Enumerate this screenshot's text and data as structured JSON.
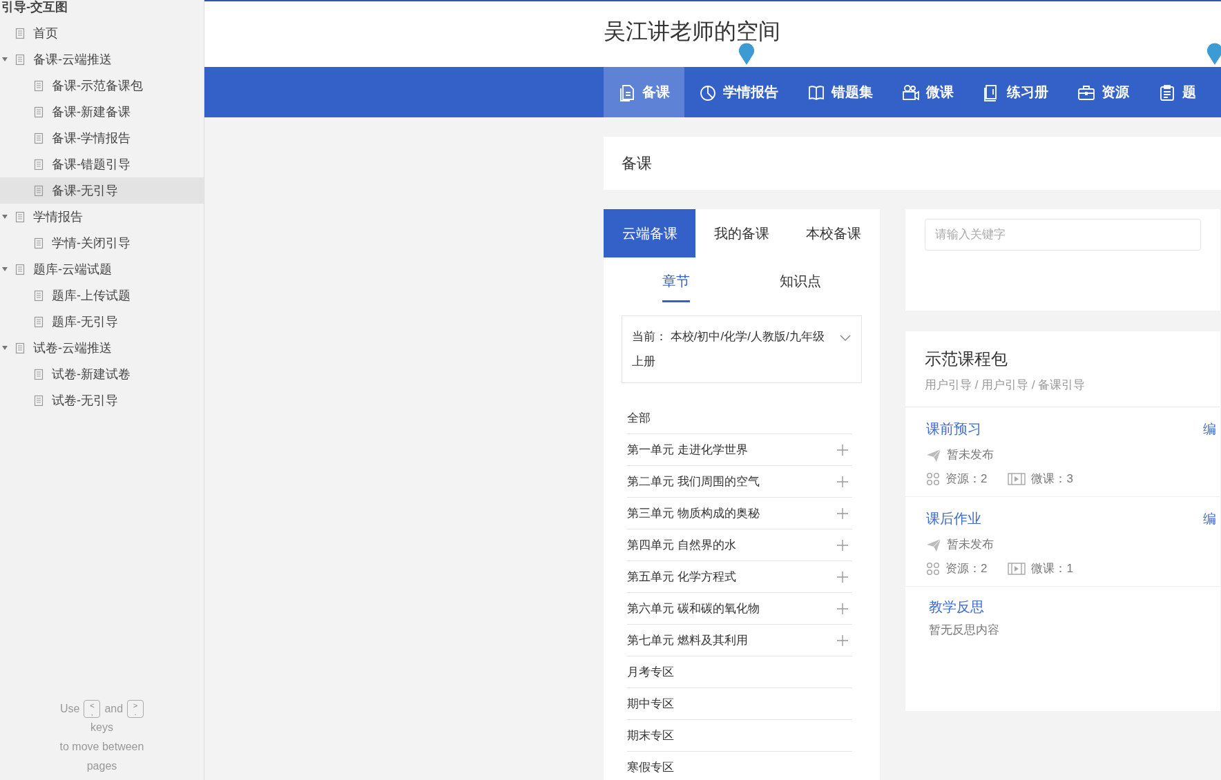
{
  "sidebar": {
    "title": "引导-交互图",
    "items": [
      {
        "label": "首页",
        "selected": false
      },
      {
        "label": "备课-云端推送",
        "selected": false,
        "expanded": true,
        "children": [
          {
            "label": "备课-示范备课包",
            "selected": false
          },
          {
            "label": "备课-新建备课",
            "selected": false
          },
          {
            "label": "备课-学情报告",
            "selected": false
          },
          {
            "label": "备课-错题引导",
            "selected": false
          },
          {
            "label": "备课-无引导",
            "selected": true
          }
        ]
      },
      {
        "label": "学情报告",
        "selected": false,
        "expanded": true,
        "children": [
          {
            "label": "学情-关闭引导",
            "selected": false
          }
        ]
      },
      {
        "label": "题库-云端试题",
        "selected": false,
        "expanded": true,
        "children": [
          {
            "label": "题库-上传试题",
            "selected": false
          },
          {
            "label": "题库-无引导",
            "selected": false
          }
        ]
      },
      {
        "label": "试卷-云端推送",
        "selected": false,
        "expanded": true,
        "children": [
          {
            "label": "试卷-新建试卷",
            "selected": false
          },
          {
            "label": "试卷-无引导",
            "selected": false
          }
        ]
      }
    ],
    "hint": {
      "before": "Use",
      "key1": {
        "upper": "<",
        "lower": ","
      },
      "middle": "and",
      "key2": {
        "upper": ">",
        "lower": "."
      },
      "after": "keys",
      "line2": "to move between pages"
    }
  },
  "header": {
    "title": "吴江讲老师的空间"
  },
  "nav": [
    {
      "label": "备课",
      "selected": true
    },
    {
      "label": "学情报告",
      "selected": false
    },
    {
      "label": "错题集",
      "selected": false
    },
    {
      "label": "微课",
      "selected": false
    },
    {
      "label": "练习册",
      "selected": false
    },
    {
      "label": "资源",
      "selected": false
    },
    {
      "label": "题",
      "selected": false
    }
  ],
  "page_title": "备课",
  "tabs": [
    {
      "label": "云端备课",
      "selected": true
    },
    {
      "label": "我的备课",
      "selected": false
    },
    {
      "label": "本校备课",
      "selected": false
    }
  ],
  "subtabs": [
    {
      "label": "章节",
      "selected": true
    },
    {
      "label": "知识点",
      "selected": false
    }
  ],
  "current": "当前： 本校/初中/化学/人教版/九年级上册",
  "chapters": [
    {
      "label": "全部",
      "expandable": false
    },
    {
      "label": "第一单元 走进化学世界",
      "expandable": true
    },
    {
      "label": "第二单元 我们周围的空气",
      "expandable": true
    },
    {
      "label": "第三单元 物质构成的奥秘",
      "expandable": true
    },
    {
      "label": "第四单元 自然界的水",
      "expandable": true
    },
    {
      "label": "第五单元 化学方程式",
      "expandable": true
    },
    {
      "label": "第六单元 碳和碳的氧化物",
      "expandable": true
    },
    {
      "label": "第七单元 燃料及其利用",
      "expandable": true
    },
    {
      "label": "月考专区",
      "expandable": false
    },
    {
      "label": "期中专区",
      "expandable": false
    },
    {
      "label": "期末专区",
      "expandable": false
    },
    {
      "label": "寒假专区",
      "expandable": false
    }
  ],
  "search": {
    "placeholder": "请输入关键字"
  },
  "package": {
    "title": "示范课程包",
    "breadcrumb": "用户引导 / 用户引导 / 备课引导",
    "sections": [
      {
        "title": "课前预习",
        "edit": "编",
        "status": "暂未发布",
        "resources": "资源：2",
        "videos": "微课：3"
      },
      {
        "title": "课后作业",
        "edit": "编",
        "status": "暂未发布",
        "resources": "资源：2",
        "videos": "微课：1"
      }
    ],
    "reflection": {
      "title": "教学反思",
      "text": "暂无反思内容"
    }
  }
}
